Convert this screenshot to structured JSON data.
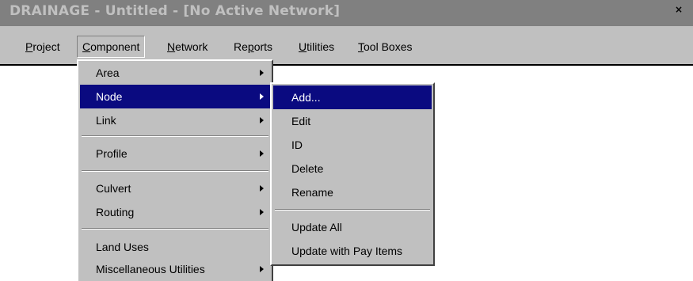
{
  "window": {
    "title": "DRAINAGE - Untitled - [No Active Network]",
    "close_glyph": "×",
    "titlebar_color": "#808080"
  },
  "menubar": {
    "items": [
      {
        "label": "Project",
        "mnemonic": "P"
      },
      {
        "label": "Component",
        "mnemonic": "C"
      },
      {
        "label": "Network",
        "mnemonic": "N"
      },
      {
        "label": "Reports",
        "mnemonic": "p"
      },
      {
        "label": "Utilities",
        "mnemonic": "U"
      },
      {
        "label": "Tool Boxes",
        "mnemonic": "T"
      }
    ],
    "open_menu": "Component"
  },
  "component_menu": {
    "items": [
      {
        "label": "Area",
        "has_submenu": true
      },
      {
        "label": "Node",
        "has_submenu": true,
        "highlighted": true
      },
      {
        "label": "Link",
        "has_submenu": true
      },
      {
        "label": "Profile",
        "has_submenu": true
      },
      {
        "label": "Culvert",
        "has_submenu": true
      },
      {
        "label": "Routing",
        "has_submenu": true
      },
      {
        "label": "Land Uses",
        "has_submenu": false
      },
      {
        "label": "Miscellaneous Utilities",
        "has_submenu": true
      }
    ]
  },
  "node_submenu": {
    "items": [
      {
        "label": "Add...",
        "highlighted": true
      },
      {
        "label": "Edit"
      },
      {
        "label": "ID"
      },
      {
        "label": "Delete"
      },
      {
        "label": "Rename"
      },
      {
        "label": "Update All"
      },
      {
        "label": "Update with Pay Items"
      }
    ]
  },
  "colors": {
    "menu_face": "#c0c0c0",
    "highlight": "#0a0a80",
    "highlight_text": "#ffffff"
  }
}
